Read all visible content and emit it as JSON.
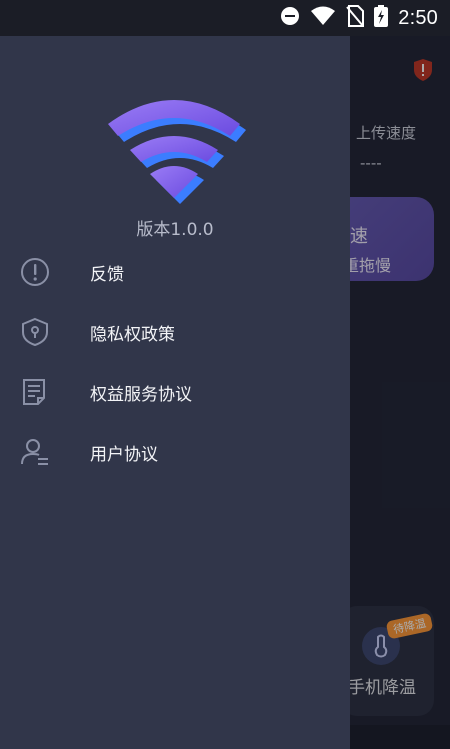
{
  "statusbar": {
    "time": "2:50"
  },
  "drawer": {
    "version": "版本1.0.0",
    "menu": [
      {
        "label": "反馈",
        "icon": "feedback-icon"
      },
      {
        "label": "隐私权政策",
        "icon": "privacy-shield-icon"
      },
      {
        "label": "权益服务协议",
        "icon": "document-icon"
      },
      {
        "label": "用户协议",
        "icon": "user-agreement-icon"
      }
    ]
  },
  "background": {
    "upload_label": "上传速度",
    "upload_value": "----",
    "speed_card_title": "速",
    "speed_card_subtitle": "重拖慢",
    "cooling_badge": "待降温",
    "cooling_label": "手机降温"
  },
  "colors": {
    "drawer_bg": "#31364a",
    "accent_purple": "#8b6cf0",
    "accent_blue": "#3b7dff",
    "warning": "#ff9a3b"
  }
}
